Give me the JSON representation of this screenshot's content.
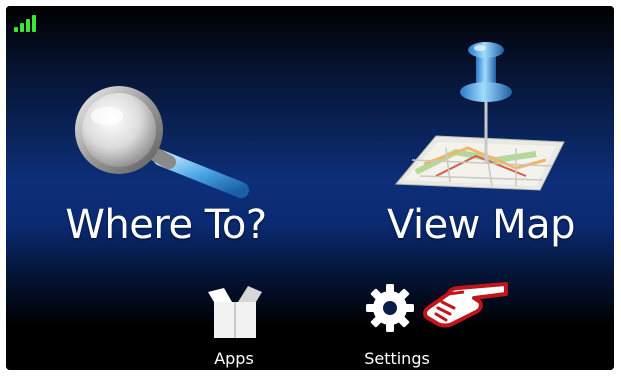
{
  "status": {
    "signal_icon": "signal-bars-icon",
    "signal_color": "#3ee63a"
  },
  "main_menu": {
    "where_to": {
      "label": "Where To?",
      "icon": "magnifying-glass-icon"
    },
    "view_map": {
      "label": "View Map",
      "icon": "map-pushpin-icon"
    }
  },
  "bottom_bar": {
    "apps": {
      "label": "Apps",
      "icon": "box-icon"
    },
    "settings": {
      "label": "Settings",
      "icon": "gear-icon"
    }
  },
  "annotation": {
    "icon": "pointing-hand-icon",
    "color": "#c0151b"
  },
  "colors": {
    "background_top": "#000000",
    "background_mid": "#0d2f78",
    "text": "#ffffff"
  }
}
